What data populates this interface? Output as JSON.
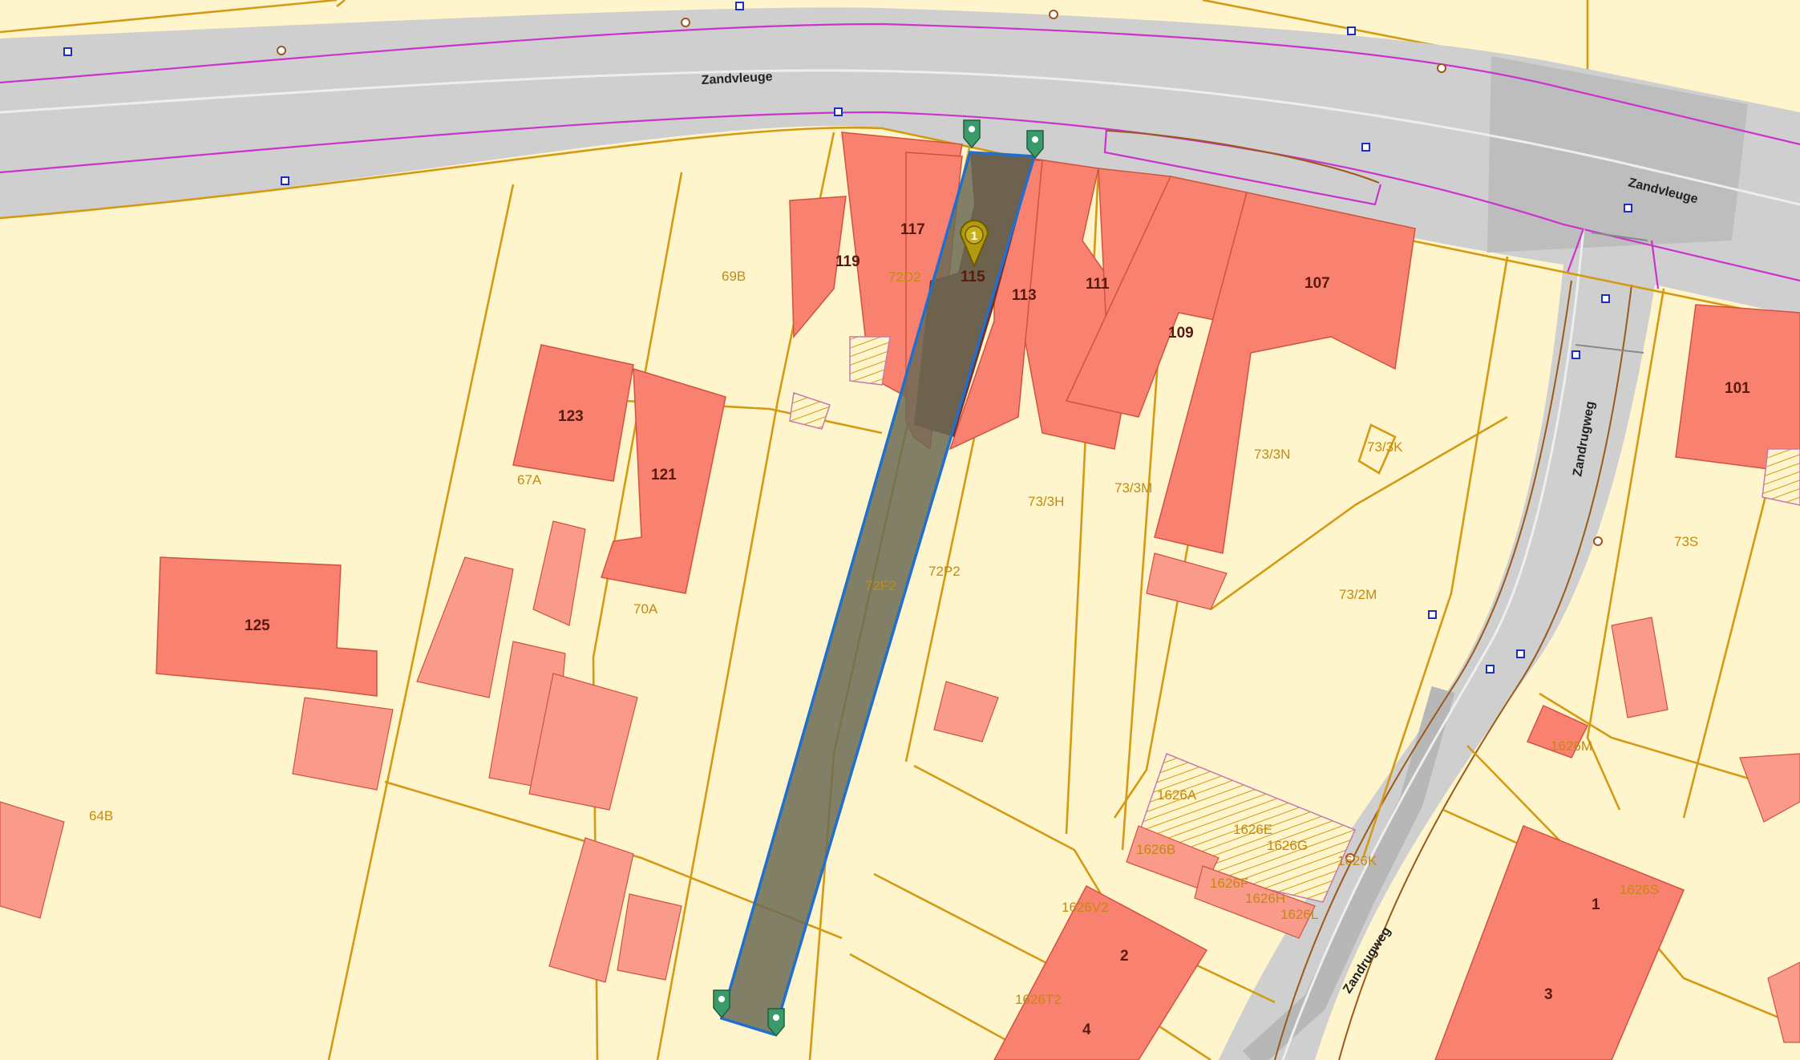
{
  "colors": {
    "ground": "#fff5cc",
    "parcel_line": "#d49a14",
    "building": "#f98170",
    "road": "#cfcfcf",
    "selection_outline": "#1f6fd0",
    "selection_fill": "#6b6b55",
    "marker_green": "#3a9a6a",
    "marker_olive": "#b29a10"
  },
  "streets": [
    {
      "name": "Zandvleuge"
    },
    {
      "name": "Zandvleuge"
    },
    {
      "name": "Zandrugweg"
    },
    {
      "name": "Zandrugweg"
    }
  ],
  "house_numbers": [
    "119",
    "117",
    "115",
    "113",
    "111",
    "109",
    "107",
    "101",
    "123",
    "121",
    "125",
    "2",
    "4",
    "1",
    "3"
  ],
  "parcel_labels": [
    "69B",
    "72D2",
    "67A",
    "70A",
    "64B",
    "72F2",
    "72P2",
    "73/3H",
    "73/3M",
    "73/3N",
    "73/3K",
    "73/2M",
    "73S",
    "1626M",
    "1626A",
    "1626B",
    "1626E",
    "1626G",
    "1626K",
    "1626F",
    "1626H",
    "1626L",
    "1626V2",
    "1626T2",
    "1626S"
  ],
  "selected_marker": {
    "number": "1",
    "icon": "map-pin-icon"
  },
  "vertex_markers": [
    {
      "icon": "map-pin-icon"
    },
    {
      "icon": "map-pin-icon"
    },
    {
      "icon": "map-pin-icon"
    },
    {
      "icon": "map-pin-icon"
    }
  ]
}
